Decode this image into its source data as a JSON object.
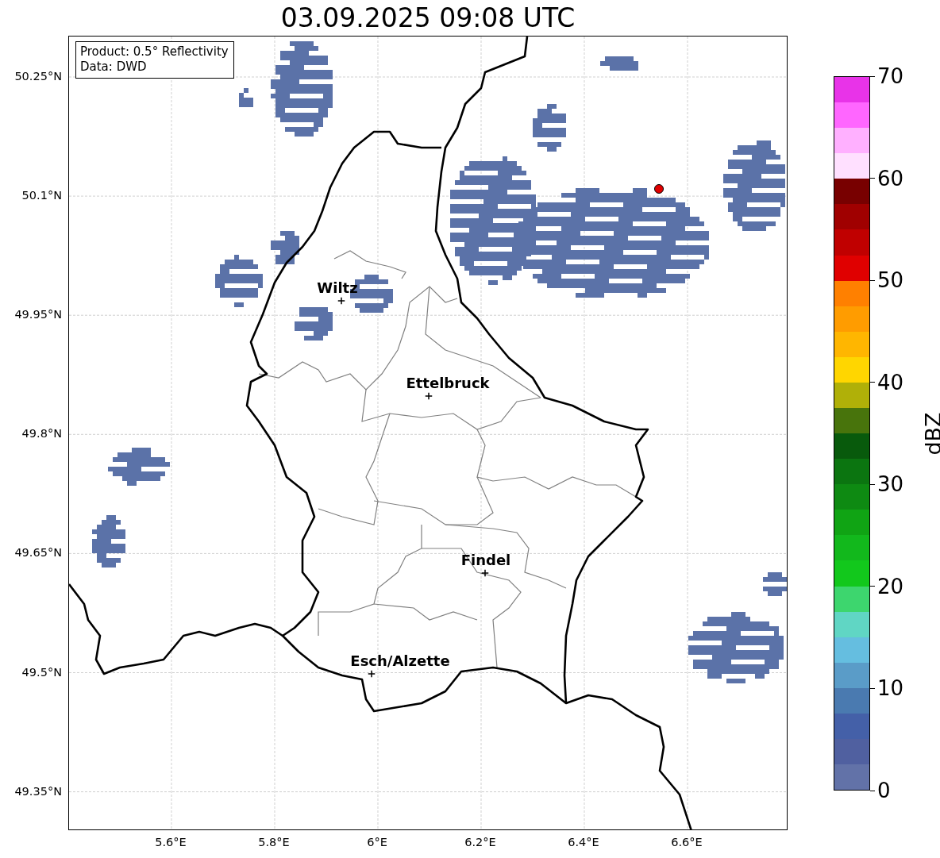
{
  "title": "03.09.2025 09:08 UTC",
  "legend": [
    "Product: 0.5° Reflectivity",
    "Data: DWD"
  ],
  "lat_ticks": [
    "50.25°N",
    "50.1°N",
    "49.95°N",
    "49.8°N",
    "49.65°N",
    "49.5°N",
    "49.35°N"
  ],
  "lon_ticks": [
    "5.6°E",
    "5.8°E",
    "6°E",
    "6.2°E",
    "6.4°E",
    "6.6°E"
  ],
  "cities": [
    {
      "name": "Wiltz"
    },
    {
      "name": "Ettelbruck"
    },
    {
      "name": "Findel"
    },
    {
      "name": "Esch/Alzette"
    }
  ],
  "colorbar": {
    "label": "dBZ",
    "ticks": [
      "70",
      "60",
      "50",
      "40",
      "30",
      "20",
      "10",
      "0"
    ],
    "bins": [
      {
        "color": "#e833e8"
      },
      {
        "color": "#ff66ff"
      },
      {
        "color": "#ffb0ff"
      },
      {
        "color": "#ffe0ff"
      },
      {
        "color": "#780000"
      },
      {
        "color": "#a00000"
      },
      {
        "color": "#c00000"
      },
      {
        "color": "#e00000"
      },
      {
        "color": "#ff8000"
      },
      {
        "color": "#ff9c00"
      },
      {
        "color": "#ffb600"
      },
      {
        "color": "#ffd600"
      },
      {
        "color": "#b0b008"
      },
      {
        "color": "#48740c"
      },
      {
        "color": "#085a0c"
      },
      {
        "color": "#0b7510"
      },
      {
        "color": "#0e8a12"
      },
      {
        "color": "#10a414"
      },
      {
        "color": "#12b81c"
      },
      {
        "color": "#12c81c"
      },
      {
        "color": "#3dd66e"
      },
      {
        "color": "#60d6c4"
      },
      {
        "color": "#65bee0"
      },
      {
        "color": "#5a9cc8"
      },
      {
        "color": "#4a7ab0"
      },
      {
        "color": "#4460a8"
      },
      {
        "color": "#5060a0"
      },
      {
        "color": "#6272a8"
      }
    ]
  }
}
